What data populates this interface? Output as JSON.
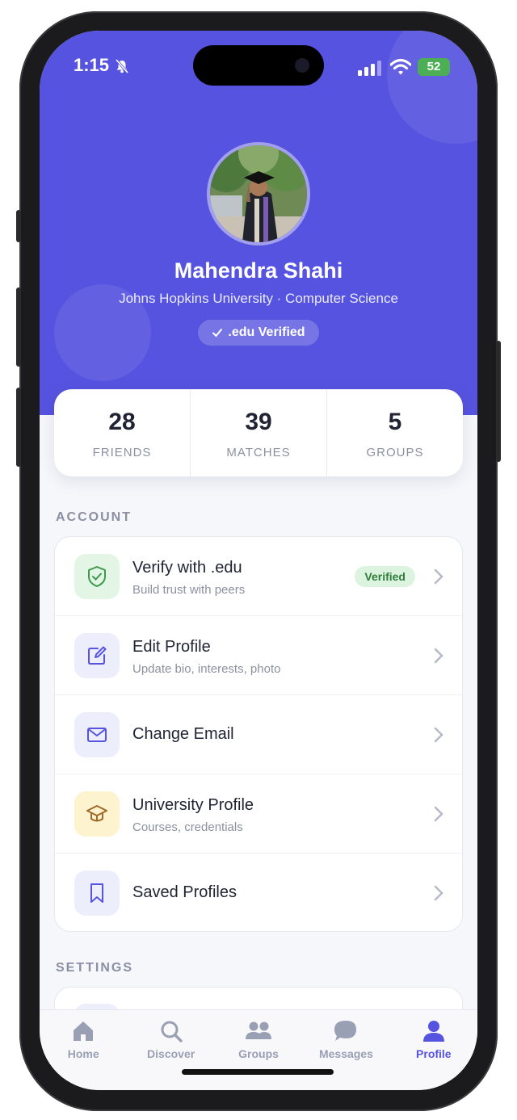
{
  "status_bar": {
    "time": "1:15",
    "battery": "52"
  },
  "profile": {
    "name": "Mahendra Shahi",
    "subtitle": "Johns Hopkins University · Computer Science",
    "verified_label": ".edu Verified"
  },
  "stats": [
    {
      "value": "28",
      "label": "FRIENDS"
    },
    {
      "value": "39",
      "label": "MATCHES"
    },
    {
      "value": "5",
      "label": "GROUPS"
    }
  ],
  "account": {
    "title": "ACCOUNT",
    "items": [
      {
        "title": "Verify with .edu",
        "subtitle": "Build trust with peers",
        "badge": "Verified",
        "icon": "shield-check-icon"
      },
      {
        "title": "Edit Profile",
        "subtitle": "Update bio, interests, photo",
        "icon": "edit-icon"
      },
      {
        "title": "Change Email",
        "icon": "mail-icon"
      },
      {
        "title": "University Profile",
        "subtitle": "Courses, credentials",
        "icon": "graduation-cap-icon"
      },
      {
        "title": "Saved Profiles",
        "icon": "bookmark-icon"
      }
    ]
  },
  "settings": {
    "title": "SETTINGS"
  },
  "tabs": [
    {
      "label": "Home",
      "icon": "home-icon"
    },
    {
      "label": "Discover",
      "icon": "search-icon"
    },
    {
      "label": "Groups",
      "icon": "groups-icon"
    },
    {
      "label": "Messages",
      "icon": "messages-icon"
    },
    {
      "label": "Profile",
      "icon": "profile-icon",
      "active": true
    }
  ],
  "colors": {
    "accent": "#5653E0",
    "verified_bg": "#DCF3DF",
    "verified_text": "#2E7D3B"
  }
}
